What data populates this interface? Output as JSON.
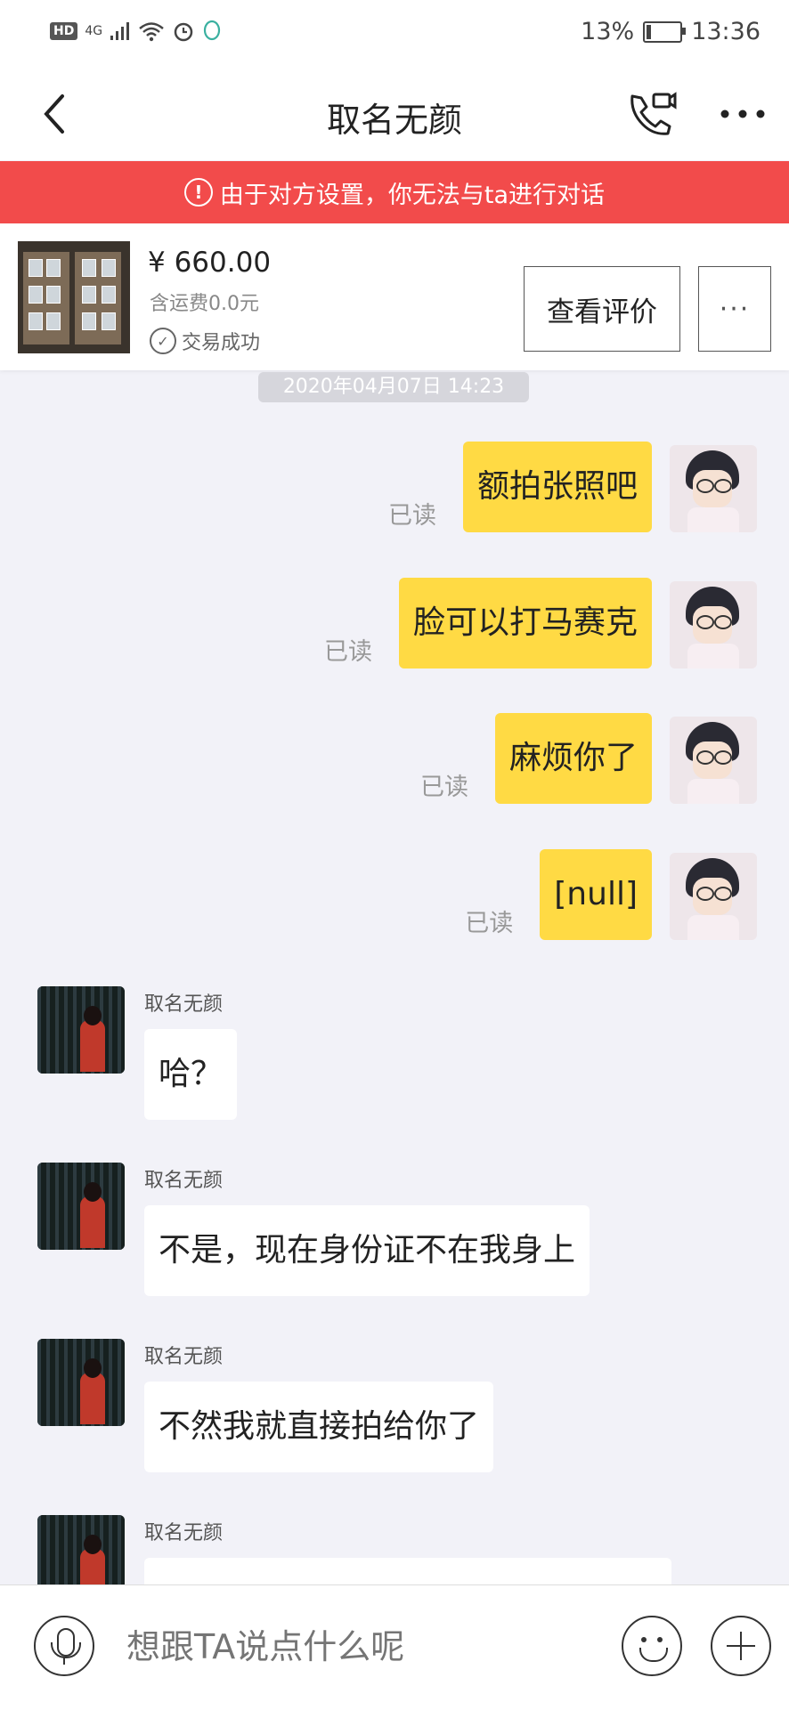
{
  "status_bar": {
    "hd": "HD",
    "signal": "4G",
    "battery": "13%",
    "time": "13:36"
  },
  "header": {
    "title": "取名无颜"
  },
  "banner": {
    "text": "由于对方设置，你无法与ta进行对话"
  },
  "product": {
    "price": "¥ 660.00",
    "shipping": "含运费0.0元",
    "status": "交易成功",
    "review_button": "查看评价",
    "more_button": "···"
  },
  "chat": {
    "timestamp": "2020年04月07日 14:23",
    "outgoing": [
      {
        "text": "额拍张照吧",
        "read": "已读"
      },
      {
        "text": "脸可以打马赛克",
        "read": "已读"
      },
      {
        "text": "麻烦你了",
        "read": "已读"
      },
      {
        "text": "[null]",
        "read": "已读"
      }
    ],
    "incoming": [
      {
        "sender": "取名无颜",
        "text": "哈？"
      },
      {
        "sender": "取名无颜",
        "text": "不是，现在身份证不在我身上"
      },
      {
        "sender": "取名无颜",
        "text": "不然我就直接拍给你了"
      },
      {
        "sender": "取名无颜",
        "text": ""
      }
    ]
  },
  "input": {
    "placeholder": "想跟TA说点什么呢"
  },
  "colors": {
    "banner": "#f24b4b",
    "bubble_out": "#ffda44",
    "background": "#f2f2f8"
  }
}
